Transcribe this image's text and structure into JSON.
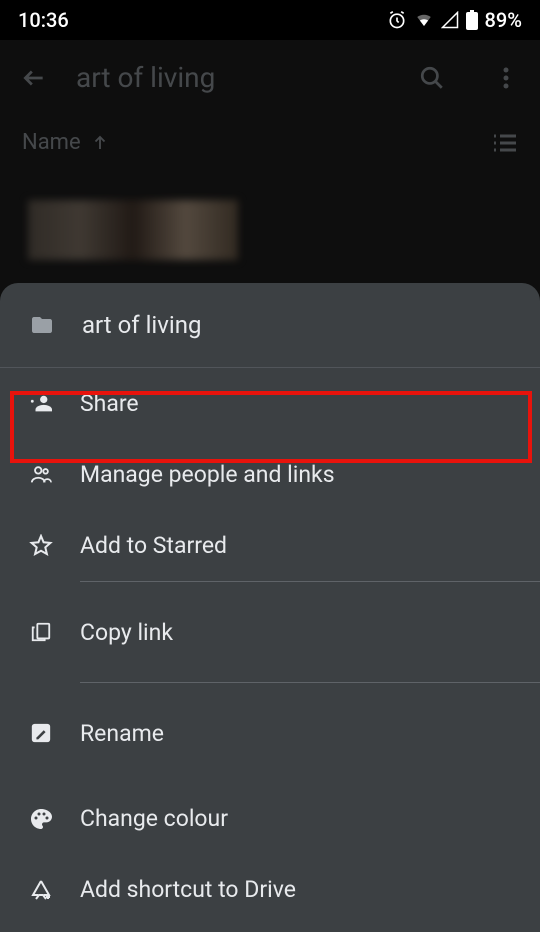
{
  "status": {
    "time": "10:36",
    "battery": "89%"
  },
  "appbar": {
    "title": "art of living"
  },
  "sort": {
    "label": "Name"
  },
  "sheet": {
    "folder_name": "art of living",
    "items": {
      "share": "Share",
      "manage": "Manage people and links",
      "starred": "Add to Starred",
      "copylink": "Copy link",
      "rename": "Rename",
      "colour": "Change colour",
      "shortcut": "Add shortcut to Drive"
    }
  }
}
